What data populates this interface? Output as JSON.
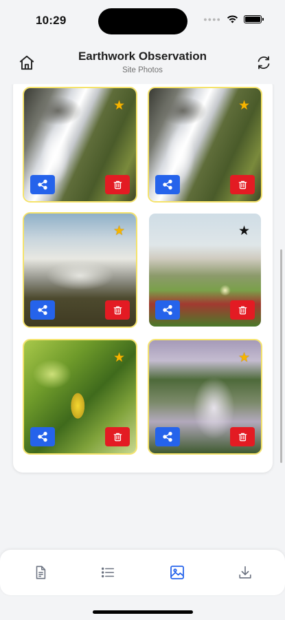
{
  "status": {
    "time": "10:29"
  },
  "header": {
    "title": "Earthwork Observation",
    "subtitle": "Site Photos"
  },
  "icons": {
    "home": "home-icon",
    "refresh": "refresh-icon",
    "share": "share-icon",
    "delete": "trash-icon",
    "favorite": "star-icon",
    "tabs": [
      "document-icon",
      "list-icon",
      "image-icon",
      "download-icon"
    ]
  },
  "colors": {
    "share_button": "#2563eb",
    "delete_button": "#e31b23",
    "favorite_star": "#f6b400",
    "favorite_border": "#f5e36a",
    "active_tab": "#2563eb",
    "inactive_tab": "#6b7280"
  },
  "photos": [
    {
      "image": "waterfall over mossy rocks",
      "favorite": true
    },
    {
      "image": "waterfall over mossy rocks",
      "favorite": true
    },
    {
      "image": "waterfall at cliff edge with sun",
      "favorite": true
    },
    {
      "image": "grass and flowers by the sea",
      "favorite": false
    },
    {
      "image": "lemon among green leaves",
      "favorite": true
    },
    {
      "image": "waterfall in green valley with mist",
      "favorite": true
    }
  ],
  "tabbar": {
    "active_index": 2
  },
  "glyphs": {
    "star": "★"
  }
}
